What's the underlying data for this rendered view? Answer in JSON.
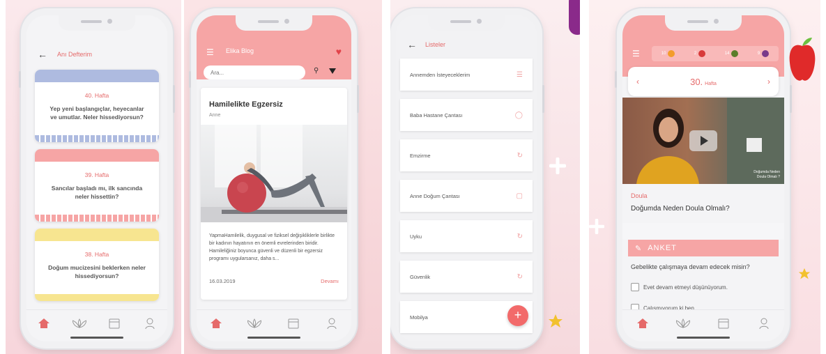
{
  "screen1": {
    "title": "Anı Defterim",
    "cards": [
      {
        "week": "40. Hafta",
        "question": "Yep yeni başlangıçlar, heyecanlar ve umutlar. Neler hissediyorsun?"
      },
      {
        "week": "39. Hafta",
        "question": "Sancılar başladı mı, ilk sancında neler hissettin?"
      },
      {
        "week": "38. Hafta",
        "question": "Doğum mucizesini beklerken neler hissediyorsun?"
      }
    ]
  },
  "screen2": {
    "brand": "Elika Blog",
    "search_placeholder": "Ara...",
    "post": {
      "title": "Hamilelikte Egzersiz",
      "category": "Anne",
      "body": "YapmaHamilelik, duygusal ve fiziksel değişikliklerle birlikte bir kadının hayatının en önemli evrelerinden biridir. Hamileliğiniz boyunca güvenli ve düzenli bir egzersiz programı uygularsanız, daha s...",
      "date": "16.03.2019",
      "more": "Devamı"
    }
  },
  "screen3": {
    "title": "Listeler",
    "items": [
      "Annemden İsteyeceklerim",
      "Baba Hastane Çantası",
      "Emzirme",
      "Anne Doğum Çantası",
      "Uyku",
      "Güvenlik",
      "Mobilya"
    ],
    "fab": "+"
  },
  "screen4": {
    "bar": [
      "10",
      "2",
      "14",
      "9"
    ],
    "week_number": "30.",
    "week_label": "Hafta",
    "video_caption_1": "Doğumda Neden",
    "video_caption_2": "Doula Olmalı ?",
    "category": "Doula",
    "video_title": "Doğumda Neden Doula Olmalı?",
    "survey_label": "ANKET",
    "survey_question": "Gebelikte çalışmaya devam edecek misin?",
    "options": [
      "Evet devam etmeyi düşünüyorum.",
      "Çalışmıyorum ki ben"
    ]
  },
  "colors": {
    "accent": "#e56a6a",
    "header_pink": "#f6a5a5",
    "fab": "#f26a6a"
  }
}
